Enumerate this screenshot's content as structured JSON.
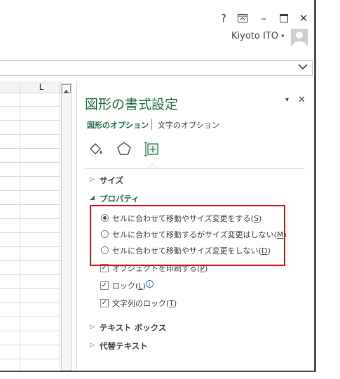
{
  "titlebar": {
    "help": "?",
    "ribbon_display": "⊼",
    "minimize": "–",
    "maximize": "☐",
    "close": "✕",
    "user_name": "Kiyoto ITO",
    "user_caret": "▾"
  },
  "formula_bar": {
    "expand_caret": "⌄"
  },
  "sheet": {
    "column_label": "L"
  },
  "pane": {
    "title": "図形の書式設定",
    "dropdown": "▾",
    "close": "✕",
    "tabs": [
      "図形のオプション",
      "文字のオプション"
    ],
    "icons": [
      "fill-line-icon",
      "effects-icon",
      "size-properties-icon"
    ],
    "sections": {
      "size": "サイズ",
      "properties": "プロパティ",
      "textbox": "テキスト ボックス",
      "alt_text": "代替テキスト"
    },
    "radio_options": [
      {
        "text": "セルに合わせて移動やサイズ変更をする(",
        "key": "S",
        "suffix": ")",
        "selected": true
      },
      {
        "text": "セルに合わせて移動するがサイズ変更はしない(",
        "key": "M",
        "suffix": ")",
        "selected": false
      },
      {
        "text": "セルに合わせて移動やサイズ変更をしない(",
        "key": "D",
        "suffix": ")",
        "selected": false
      }
    ],
    "checkboxes": [
      {
        "text": "オブジェクトを印刷する(",
        "key": "P",
        "suffix": ")",
        "checked": true
      },
      {
        "text": "ロック(",
        "key": "L",
        "suffix": ")",
        "checked": true
      },
      {
        "text": "文字列のロック(",
        "key": "T",
        "suffix": ")",
        "checked": true
      }
    ],
    "info_glyph": "i"
  },
  "colors": {
    "accent": "#217346",
    "highlight": "#e01b24"
  }
}
